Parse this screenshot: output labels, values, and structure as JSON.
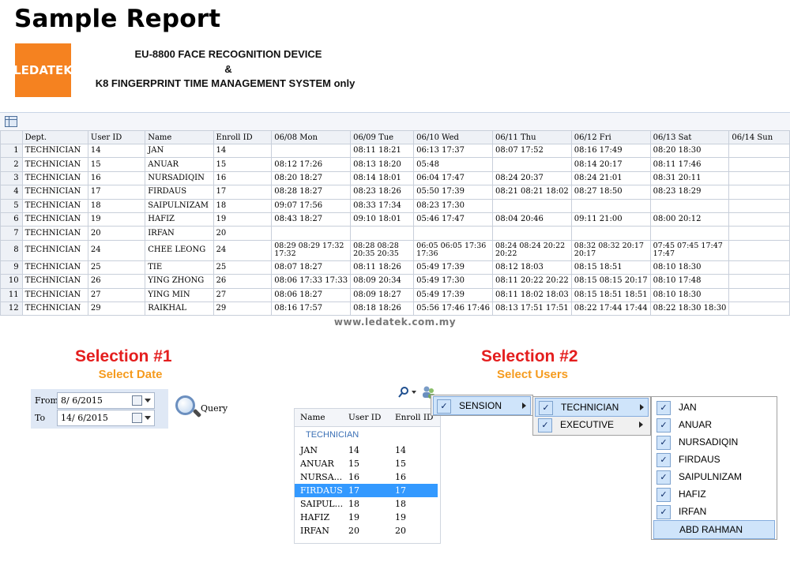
{
  "header": {
    "title": "Sample Report",
    "logo": "LEDATEK",
    "line1": "EU-8800 FACE RECOGNITION DEVICE",
    "line2": "&",
    "line3": "K8 FINGERPRINT TIME MANAGEMENT SYSTEM only"
  },
  "report": {
    "columns": [
      "",
      "Dept.",
      "User ID",
      "Name",
      "Enroll ID",
      "06/08 Mon",
      "06/09 Tue",
      "06/10 Wed",
      "06/11 Thu",
      "06/12 Fri",
      "06/13 Sat",
      "06/14 Sun"
    ],
    "rows": [
      [
        "1",
        "TECHNICIAN",
        "14",
        "JAN",
        "14",
        "",
        "08:11 18:21",
        "06:13 17:37",
        "08:07 17:52",
        "08:16 17:49",
        "08:20 18:30",
        ""
      ],
      [
        "2",
        "TECHNICIAN",
        "15",
        "ANUAR",
        "15",
        "08:12 17:26",
        "08:13 18:20",
        "05:48",
        "",
        "08:14 20:17",
        "08:11 17:46",
        ""
      ],
      [
        "3",
        "TECHNICIAN",
        "16",
        "NURSADIQIN",
        "16",
        "08:20 18:27",
        "08:14 18:01",
        "06:04 17:47",
        "08:24 20:37",
        "08:24 21:01",
        "08:31 20:11",
        ""
      ],
      [
        "4",
        "TECHNICIAN",
        "17",
        "FIRDAUS",
        "17",
        "08:28 18:27",
        "08:23 18:26",
        "05:50 17:39",
        "08:21 08:21 18:02",
        "08:27 18:50",
        "08:23 18:29",
        ""
      ],
      [
        "5",
        "TECHNICIAN",
        "18",
        "SAIPULNIZAM",
        "18",
        "09:07 17:56",
        "08:33 17:34",
        "08:23 17:30",
        "",
        "",
        "",
        ""
      ],
      [
        "6",
        "TECHNICIAN",
        "19",
        "HAFIZ",
        "19",
        "08:43 18:27",
        "09:10 18:01",
        "05:46 17:47",
        "08:04 20:46",
        "09:11 21:00",
        "08:00 20:12",
        ""
      ],
      [
        "7",
        "TECHNICIAN",
        "20",
        "IRFAN",
        "20",
        "",
        "",
        "",
        "",
        "",
        "",
        ""
      ],
      [
        "8",
        "TECHNICIAN",
        "24",
        "CHEE LEONG",
        "24",
        "08:29 08:29 17:32 17:32",
        "08:28 08:28 20:35 20:35",
        "06:05 06:05 17:36 17:36",
        "08:24 08:24 20:22 20:22",
        "08:32 08:32 20:17 20:17",
        "07:45 07:45 17:47 17:47",
        ""
      ],
      [
        "9",
        "TECHNICIAN",
        "25",
        "TIE",
        "25",
        "08:07 18:27",
        "08:11 18:26",
        "05:49 17:39",
        "08:12 18:03",
        "08:15 18:51",
        "08:10 18:30",
        ""
      ],
      [
        "10",
        "TECHNICIAN",
        "26",
        "YING ZHONG",
        "26",
        "08:06 17:33 17:33",
        "08:09 20:34",
        "05:49 17:30",
        "08:11 20:22 20:22",
        "08:15 08:15 20:17",
        "08:10 17:48",
        ""
      ],
      [
        "11",
        "TECHNICIAN",
        "27",
        "YING MIN",
        "27",
        "08:06 18:27",
        "08:09 18:27",
        "05:49 17:39",
        "08:11 18:02 18:03",
        "08:15 18:51 18:51",
        "08:10 18:30",
        ""
      ],
      [
        "12",
        "TECHNICIAN",
        "29",
        "RAIKHAL",
        "29",
        "08:16 17:57",
        "08:18 18:26",
        "05:56 17:46 17:46",
        "08:13 17:51 17:51",
        "08:22 17:44 17:44",
        "08:22 18:30 18:30",
        ""
      ]
    ]
  },
  "watermark": "www.ledatek.com.my",
  "selection1": {
    "title": "Selection #1",
    "subtitle": "Select Date",
    "from_label": "From",
    "from_value": "8/ 6/2015",
    "to_label": "To",
    "to_value": "14/ 6/2015",
    "query_label": "Query"
  },
  "selection2": {
    "title": "Selection #2",
    "subtitle": "Select Users",
    "list_headers": [
      "Name",
      "User ID",
      "Enroll ID"
    ],
    "group": "TECHNICIAN",
    "list_rows": [
      [
        "JAN",
        "14",
        "14"
      ],
      [
        "ANUAR",
        "15",
        "15"
      ],
      [
        "NURSA...",
        "16",
        "16"
      ],
      [
        "FIRDAUS",
        "17",
        "17"
      ],
      [
        "SAIPUL...",
        "18",
        "18"
      ],
      [
        "HAFIZ",
        "19",
        "19"
      ],
      [
        "IRFAN",
        "20",
        "20"
      ]
    ],
    "selected_row": 3,
    "menu1": [
      {
        "label": "SENSION",
        "checked": true
      }
    ],
    "menu2": [
      {
        "label": "TECHNICIAN",
        "checked": true
      },
      {
        "label": "EXECUTIVE",
        "checked": true
      }
    ],
    "menu3": [
      {
        "label": "JAN",
        "checked": true
      },
      {
        "label": "ANUAR",
        "checked": true
      },
      {
        "label": "NURSADIQIN",
        "checked": true
      },
      {
        "label": "FIRDAUS",
        "checked": true
      },
      {
        "label": "SAIPULNIZAM",
        "checked": true
      },
      {
        "label": "HAFIZ",
        "checked": true
      },
      {
        "label": "IRFAN",
        "checked": true
      },
      {
        "label": "ABD RAHMAN",
        "checked": false
      }
    ]
  },
  "colors": {
    "logo": "#F58220",
    "selection_title": "#E41E1E",
    "selection_subtitle": "#F59B1E",
    "row_highlight": "#3399ff"
  },
  "icons": [
    "grid-icon",
    "calendar-icon",
    "dropdown-arrow-icon",
    "magnifier-icon",
    "search-icon",
    "users-icon",
    "checkmark-icon",
    "submenu-arrow-icon"
  ]
}
